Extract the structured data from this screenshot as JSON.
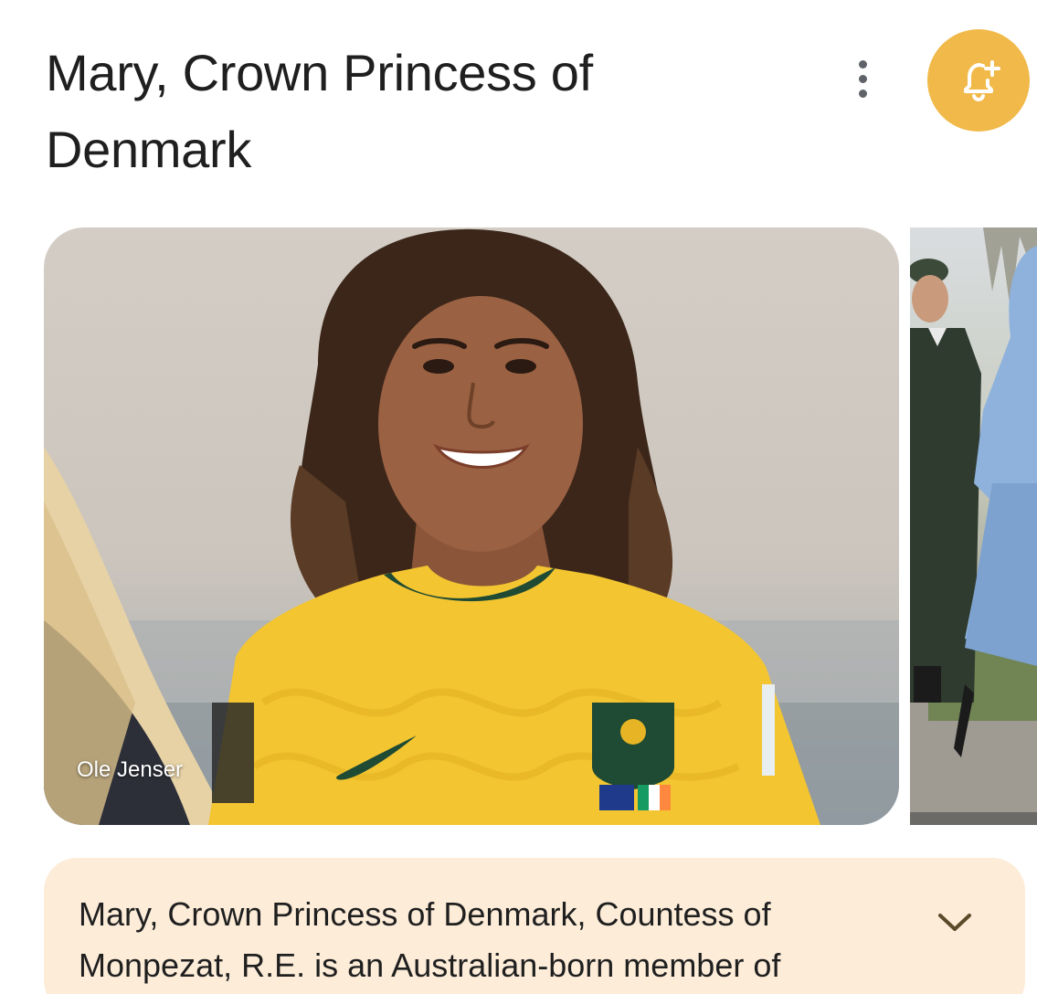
{
  "header": {
    "title": "Mary, Crown Princess of Denmark",
    "more_icon": "more-vert-icon",
    "follow_icon": "bell-plus-icon"
  },
  "gallery": {
    "main_caption": "Ole Jenser"
  },
  "summary": {
    "text": "Mary, Crown Princess of Denmark, Countess of Monpezat, R.E. is an Australian-born member of",
    "expand_icon": "chevron-down-icon"
  },
  "colors": {
    "accent": "#f1b94a",
    "card": "#fcecd8",
    "jersey": "#f3c531",
    "jersey_trim": "#1f4a33"
  }
}
